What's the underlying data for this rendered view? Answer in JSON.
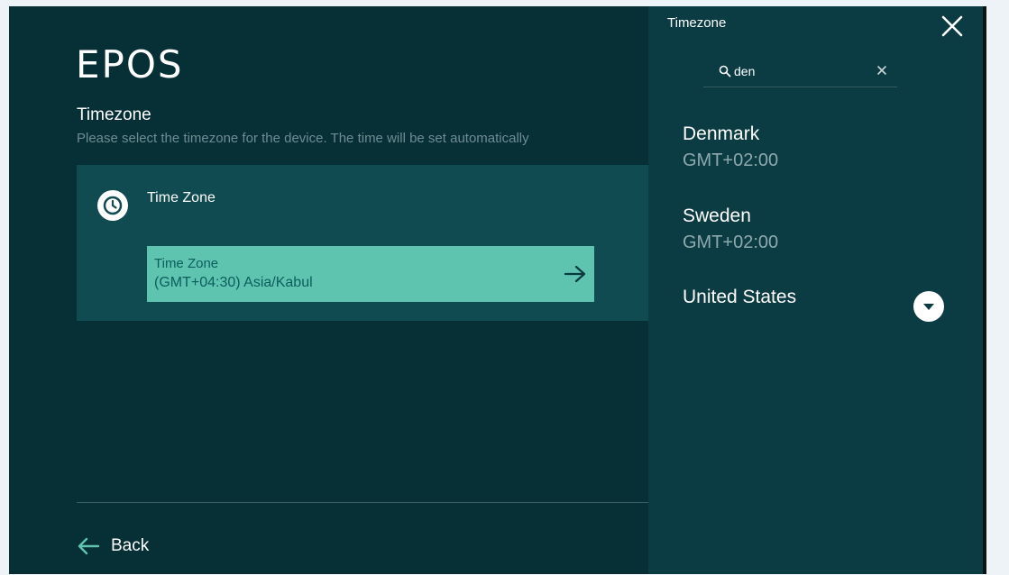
{
  "brand": {
    "logo": "EPOS"
  },
  "main": {
    "title": "Timezone",
    "description": "Please select the timezone for the device. The time will be set automatically",
    "card": {
      "label": "Time Zone",
      "button": {
        "label": "Time Zone",
        "value": "(GMT+04:30) Asia/Kabul"
      }
    },
    "back_label": "Back"
  },
  "panel": {
    "title": "Timezone",
    "search": {
      "value": "den",
      "placeholder": ""
    },
    "results": [
      {
        "name": "Denmark",
        "offset": "GMT+02:00"
      },
      {
        "name": "Sweden",
        "offset": "GMT+02:00"
      },
      {
        "name": "United States",
        "offset": ""
      }
    ]
  },
  "colors": {
    "background": "#072f36",
    "card": "#0f4b50",
    "accent": "#5ec4b0",
    "panel": "#0c3c43"
  },
  "icons": [
    "clock-icon",
    "arrow-right-icon",
    "arrow-left-icon",
    "close-icon",
    "search-icon",
    "clear-icon",
    "chevron-down-icon"
  ]
}
